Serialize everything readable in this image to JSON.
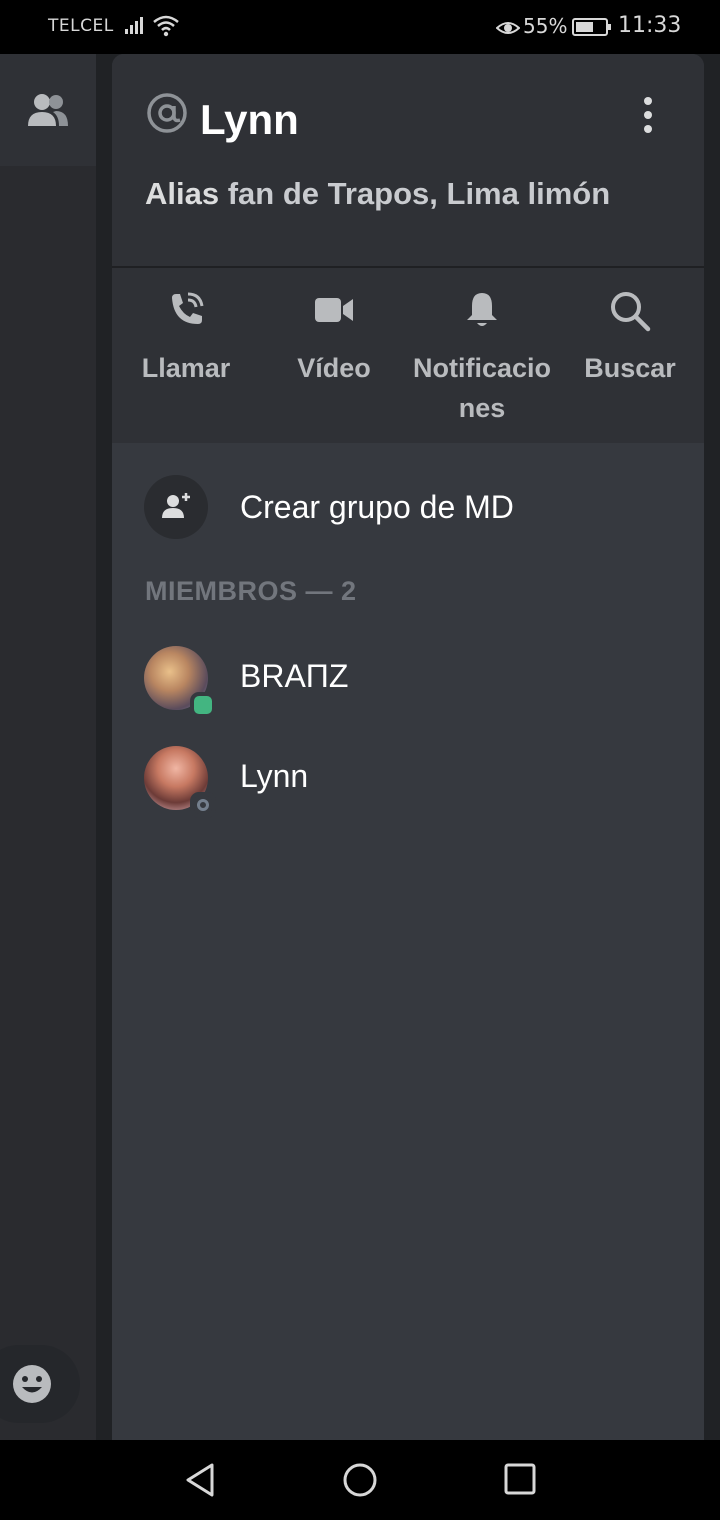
{
  "status_bar": {
    "carrier": "TELCEL",
    "battery_percent": "55%",
    "time": "11:33"
  },
  "drawer": {
    "title_prefix_icon": "at-sign-icon",
    "title": "Lynn",
    "alias_label": "Alias",
    "alias_value": "fan de Trapos, Lima limón",
    "actions": [
      {
        "label": "Llamar",
        "icon": "phone-call-icon"
      },
      {
        "label": "Vídeo",
        "icon": "video-camera-icon"
      },
      {
        "label": "Notificacio\nnes",
        "icon": "bell-icon"
      },
      {
        "label": "Buscar",
        "icon": "search-icon"
      }
    ],
    "create_group_label": "Crear grupo de MD",
    "members_header": "MIEMBROS — 2",
    "members": [
      {
        "name": "BRAΠZ",
        "status": "online"
      },
      {
        "name": "Lynn",
        "status": "offline"
      }
    ]
  },
  "colors": {
    "drawer_bg": "#36393f",
    "header_bg": "#2f3136",
    "online": "#43b581",
    "muted_text": "#72767d"
  }
}
